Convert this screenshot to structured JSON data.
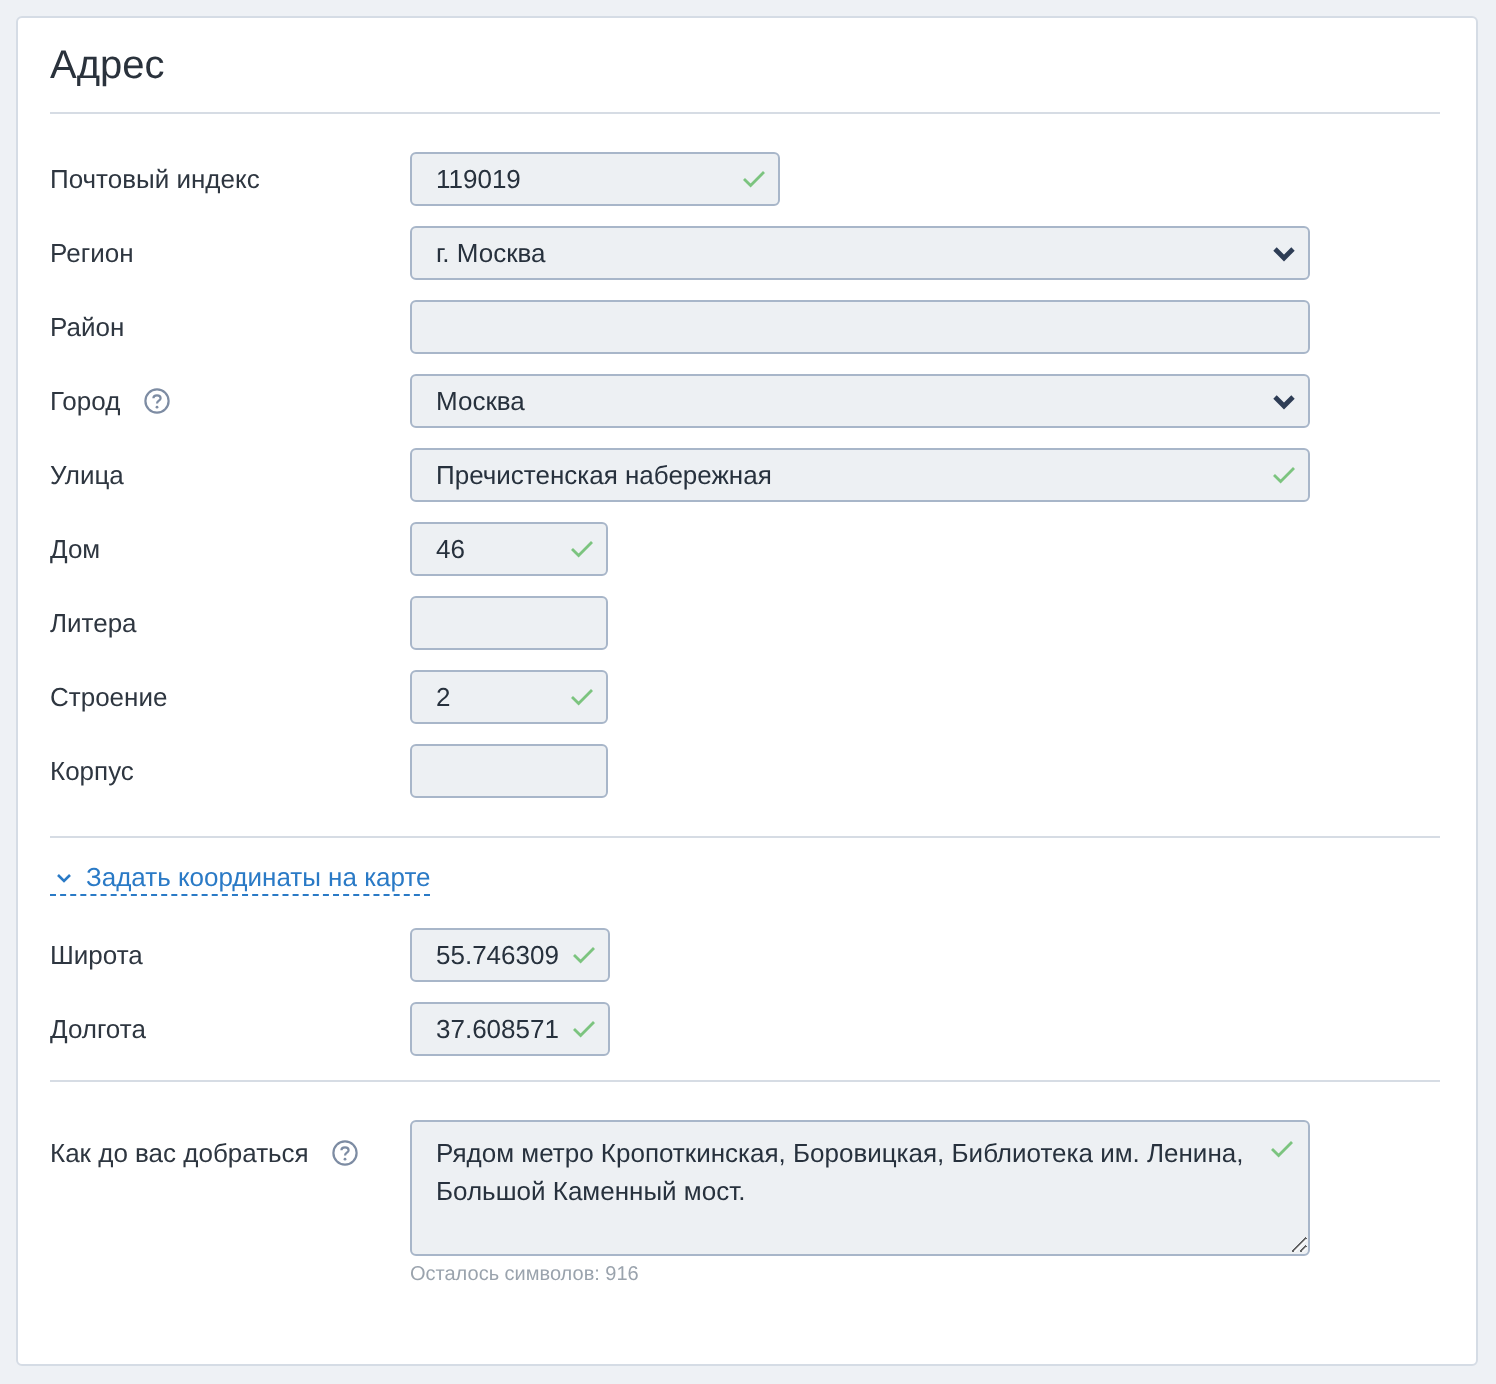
{
  "title": "Адрес",
  "address_fields": [
    {
      "kind": "text",
      "label": "Почтовый индекс",
      "value": "119019",
      "valid": true,
      "help": false
    },
    {
      "kind": "select",
      "label": "Регион",
      "value": "г. Москва",
      "valid": false,
      "help": false
    },
    {
      "kind": "text",
      "label": "Район",
      "valid": false,
      "help": false
    },
    {
      "kind": "select",
      "label": "Город",
      "value": "Москва",
      "valid": false,
      "help": true
    },
    {
      "kind": "text",
      "label": "Улица",
      "value": "Пречистенская набережная",
      "valid": true,
      "help": false
    },
    {
      "kind": "text",
      "label": "Дом",
      "value": "46",
      "valid": true,
      "help": false
    },
    {
      "kind": "text",
      "label": "Литера",
      "valid": false,
      "help": false
    },
    {
      "kind": "text",
      "label": "Строение",
      "value": "2",
      "valid": true,
      "help": false
    },
    {
      "kind": "text",
      "label": "Корпус",
      "valid": false,
      "help": false
    }
  ],
  "coordinates": {
    "toggle": {
      "label": "Задать координаты на карте",
      "expanded": true
    },
    "fields": [
      {
        "kind": "text",
        "label": "Широта",
        "value": "55.746309",
        "valid": true,
        "help": false
      },
      {
        "kind": "text",
        "label": "Долгота",
        "value": "37.608571",
        "valid": true,
        "help": false
      }
    ]
  },
  "directions": {
    "label": "Как до вас добраться",
    "help": true,
    "value": "Рядом метро Кропоткинская, Боровицкая, Библиотека им. Ленина, Большой Каменный мост.",
    "valid": true,
    "counter": "Осталось символов: 916"
  }
}
